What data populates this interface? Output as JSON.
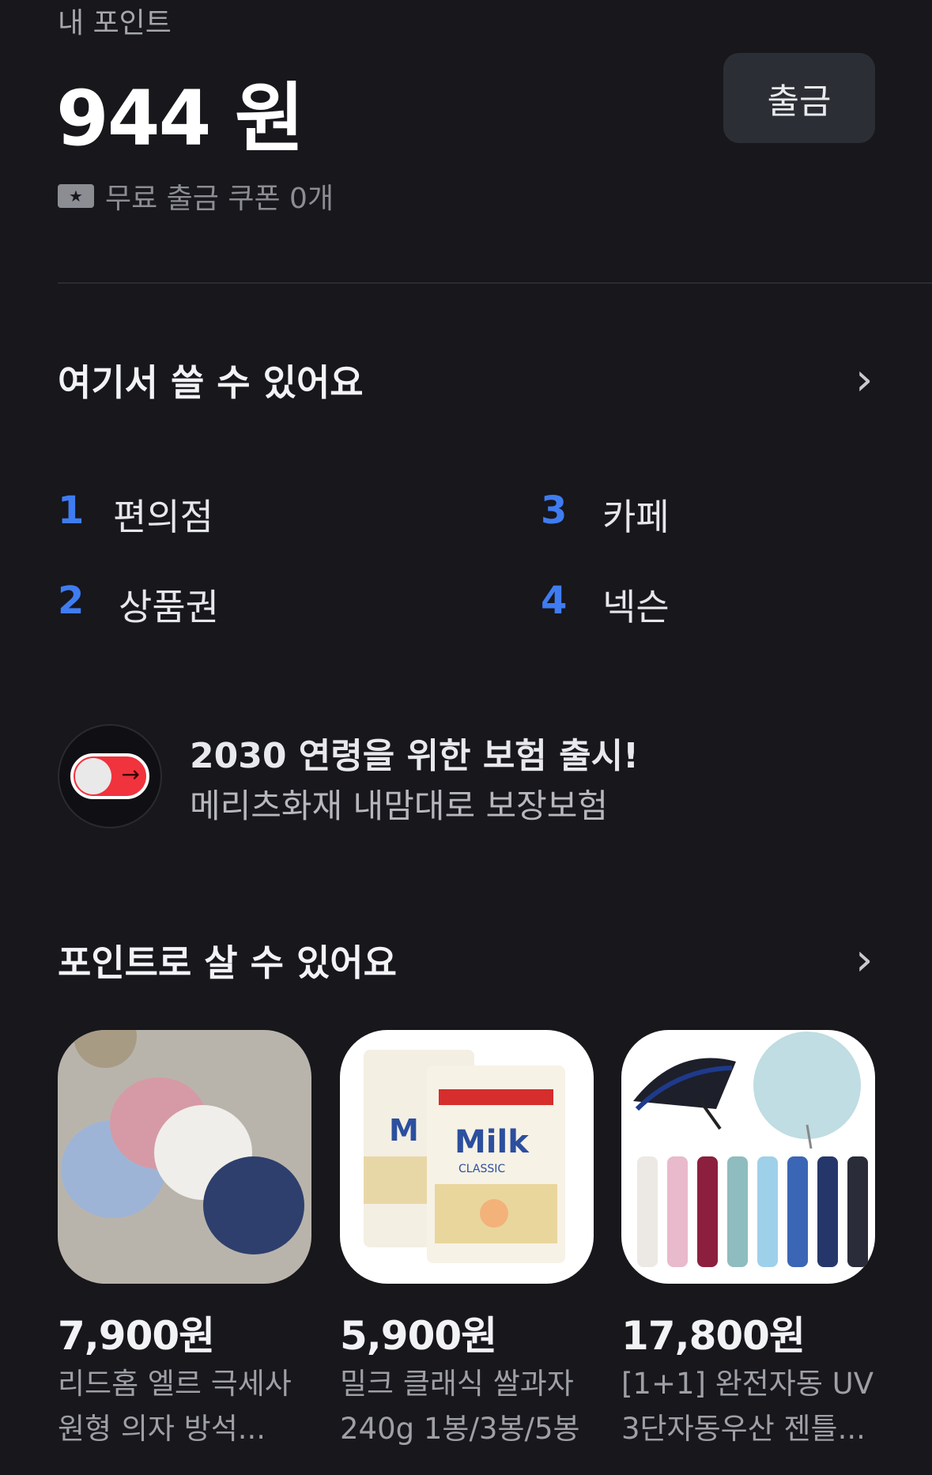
{
  "header": {
    "title": "내 포인트",
    "points": "944 원",
    "withdraw_label": "출금",
    "coupon_text": "무료 출금 쿠폰 0개"
  },
  "usable_section": {
    "title": "여기서 쓸 수 있어요",
    "rankings": [
      {
        "rank": "1",
        "label": "편의점"
      },
      {
        "rank": "2",
        "label": "상품권"
      },
      {
        "rank": "3",
        "label": "카페"
      },
      {
        "rank": "4",
        "label": "넥슨"
      }
    ]
  },
  "promo": {
    "title": "2030 연령을 위한 보험 출시!",
    "subtitle": "메리츠화재 내맘대로 보장보험"
  },
  "shop_section": {
    "title": "포인트로 살 수 있어요",
    "products": [
      {
        "price": "7,900원",
        "name_line1": "리드홈 엘르 극세사",
        "name_line2": "원형 의자 방석..."
      },
      {
        "price": "5,900원",
        "name_line1": "밀크 클래식 쌀과자",
        "name_line2": "240g 1봉/3봉/5봉"
      },
      {
        "price": "17,800원",
        "name_line1": "[1+1] 완전자동 UV",
        "name_line2": "3단자동우산 젠틀..."
      }
    ],
    "milk_brand": "Milk",
    "milk_sub": "CLASSIC",
    "milk_clipped": "M"
  },
  "colors": {
    "background": "#17171c",
    "accent_blue": "#3f7cf1",
    "toggle_red": "#f0333d"
  }
}
